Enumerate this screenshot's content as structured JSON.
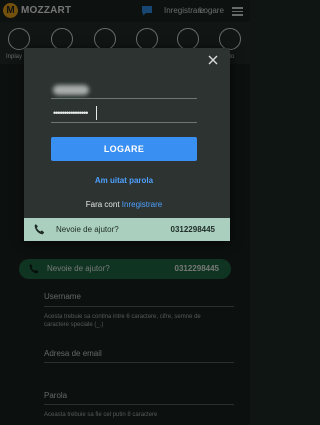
{
  "header": {
    "brand": "MOZZART",
    "logo_letter": "M",
    "register_label": "Inregistrare",
    "login_label": "Logare"
  },
  "sports_bar": {
    "items": [
      {
        "icon": "live-icon",
        "label": "Inplay"
      },
      {
        "icon": "sports-icon",
        "label": ""
      },
      {
        "icon": "racing-icon",
        "label": ""
      },
      {
        "icon": "casino-icon",
        "label": ""
      },
      {
        "icon": "virtuals-icon",
        "label": ""
      },
      {
        "icon": "lotto-icon",
        "label": "Lotto"
      }
    ]
  },
  "background_form": {
    "help_text": "Nevoie de ajutor?",
    "help_phone": "0312298445",
    "username_label": "Username",
    "username_hint": "Acesta trebuie sa contina intre 6 caractere, cifre, semne de caractere speciale (_.)",
    "email_label": "Adresa de email",
    "password_label": "Parola",
    "password_hint": "Aceasta trebuie sa fie cel putin 8 caractere"
  },
  "login_modal": {
    "username_value": "",
    "password_value": "••••••••••••••••",
    "login_button": "LOGARE",
    "forgot_password": "Am uitat parola",
    "no_account_text": "Fara cont",
    "register_link": "Inregistrare",
    "help_text": "Nevoie de ajutor?",
    "help_phone": "0312298445"
  },
  "colors": {
    "accent": "#3a8ff2",
    "brand": "#e9a11a",
    "help_strip": "#aacfbe",
    "help_pill": "#1f6a45",
    "link": "#4fa0ff"
  }
}
